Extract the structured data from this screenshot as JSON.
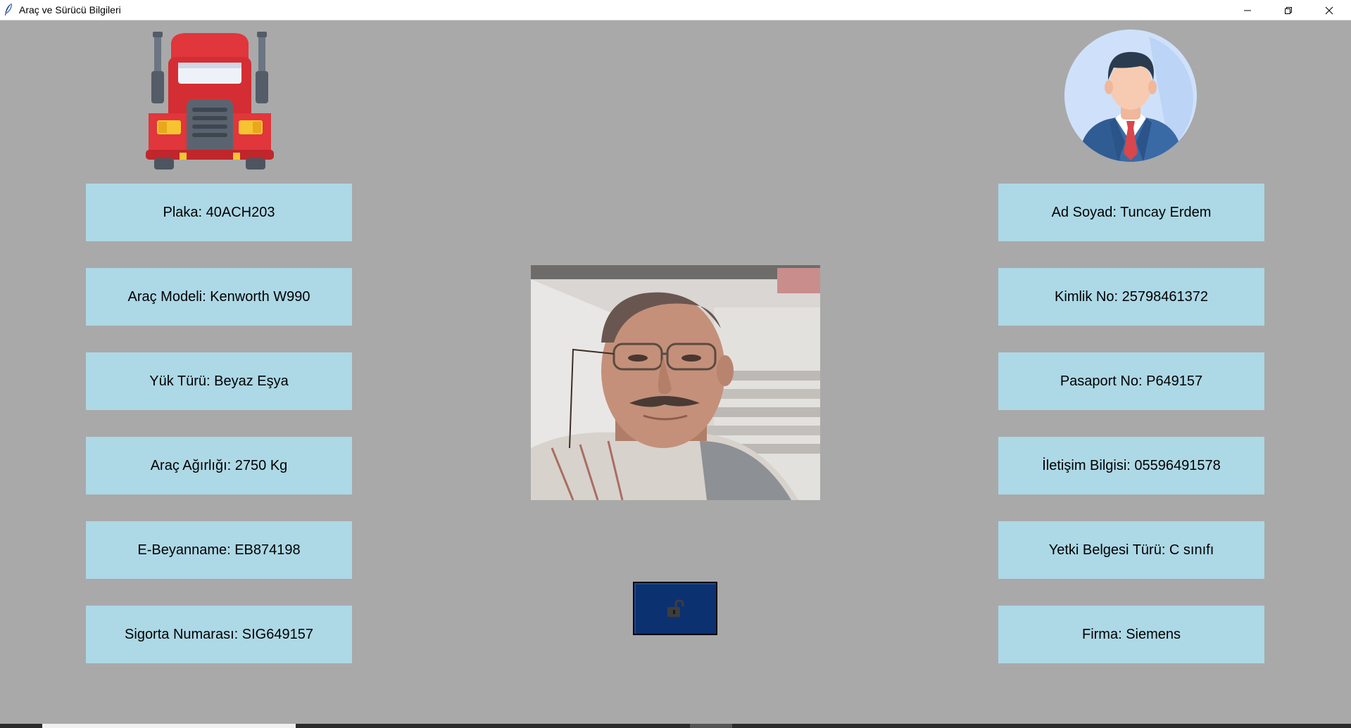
{
  "window": {
    "title": "Araç ve Sürücü Bilgileri",
    "controls": {
      "minimize_icon": "minimize-icon",
      "maximize_icon": "restore-icon",
      "close_icon": "close-icon"
    }
  },
  "colors": {
    "background": "#a9a9a9",
    "info_box": "#add8e6",
    "lock_button": "#0c3170"
  },
  "vehicle": {
    "icon": "truck-icon",
    "fields": [
      {
        "label": "Plaka: 40ACH203"
      },
      {
        "label": "Araç Modeli: Kenworth W990"
      },
      {
        "label": "Yük Türü: Beyaz Eşya"
      },
      {
        "label": "Araç Ağırlığı: 2750 Kg"
      },
      {
        "label": "E-Beyanname: EB874198"
      },
      {
        "label": "Sigorta Numarası: SIG649157"
      }
    ]
  },
  "driver": {
    "icon": "driver-avatar-icon",
    "fields": [
      {
        "label": "Ad Soyad: Tuncay Erdem"
      },
      {
        "label": "Kimlik No: 25798461372"
      },
      {
        "label": "Pasaport No: P649157"
      },
      {
        "label": "İletişim Bilgisi: 05596491578"
      },
      {
        "label": "Yetki Belgesi Türü: C sınıfı"
      },
      {
        "label": "Firma: Siemens"
      }
    ],
    "photo": "driver-photo"
  },
  "lock_button": {
    "icon": "unlocked-padlock-icon"
  }
}
